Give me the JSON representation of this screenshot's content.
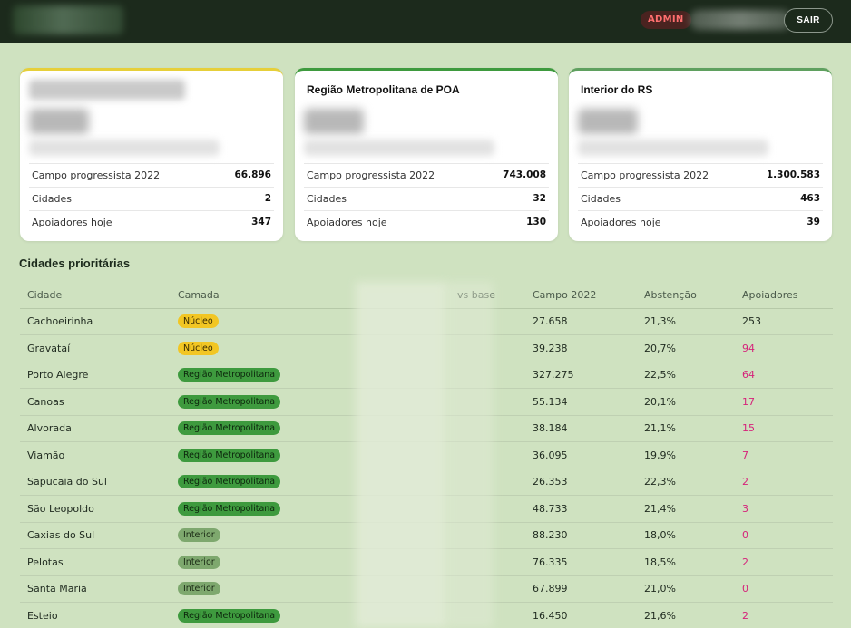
{
  "header": {
    "admin_label": "ADMIN",
    "logout_label": "SAIR"
  },
  "cards": [
    {
      "title": "",
      "rows": [
        {
          "label": "Campo progressista 2022",
          "value": "66.896"
        },
        {
          "label": "Cidades",
          "value": "2"
        },
        {
          "label": "Apoiadores hoje",
          "value": "347"
        }
      ]
    },
    {
      "title": "Região Metropolitana de POA",
      "rows": [
        {
          "label": "Campo progressista 2022",
          "value": "743.008"
        },
        {
          "label": "Cidades",
          "value": "32"
        },
        {
          "label": "Apoiadores hoje",
          "value": "130"
        }
      ]
    },
    {
      "title": "Interior do RS",
      "rows": [
        {
          "label": "Campo progressista 2022",
          "value": "1.300.583"
        },
        {
          "label": "Cidades",
          "value": "463"
        },
        {
          "label": "Apoiadores hoje",
          "value": "39"
        }
      ]
    }
  ],
  "section_title": "Cidades prioritárias",
  "table": {
    "headers": {
      "cidade": "Cidade",
      "camada": "Camada",
      "vs_base": "vs base",
      "campo": "Campo 2022",
      "abstencao": "Abstenção",
      "apoiadores": "Apoiadores"
    },
    "rows": [
      {
        "cidade": "Cachoeirinha",
        "camada": "Núcleo",
        "campo": "27.658",
        "abstencao": "21,3%",
        "apoiadores": "253"
      },
      {
        "cidade": "Gravataí",
        "camada": "Núcleo",
        "campo": "39.238",
        "abstencao": "20,7%",
        "apoiadores": "94"
      },
      {
        "cidade": "Porto Alegre",
        "camada": "Região Metropolitana",
        "campo": "327.275",
        "abstencao": "22,5%",
        "apoiadores": "64"
      },
      {
        "cidade": "Canoas",
        "camada": "Região Metropolitana",
        "campo": "55.134",
        "abstencao": "20,1%",
        "apoiadores": "17"
      },
      {
        "cidade": "Alvorada",
        "camada": "Região Metropolitana",
        "campo": "38.184",
        "abstencao": "21,1%",
        "apoiadores": "15"
      },
      {
        "cidade": "Viamão",
        "camada": "Região Metropolitana",
        "campo": "36.095",
        "abstencao": "19,9%",
        "apoiadores": "7"
      },
      {
        "cidade": "Sapucaia do Sul",
        "camada": "Região Metropolitana",
        "campo": "26.353",
        "abstencao": "22,3%",
        "apoiadores": "2"
      },
      {
        "cidade": "São Leopoldo",
        "camada": "Região Metropolitana",
        "campo": "48.733",
        "abstencao": "21,4%",
        "apoiadores": "3"
      },
      {
        "cidade": "Caxias do Sul",
        "camada": "Interior",
        "campo": "88.230",
        "abstencao": "18,0%",
        "apoiadores": "0"
      },
      {
        "cidade": "Pelotas",
        "camada": "Interior",
        "campo": "76.335",
        "abstencao": "18,5%",
        "apoiadores": "2"
      },
      {
        "cidade": "Santa Maria",
        "camada": "Interior",
        "campo": "67.899",
        "abstencao": "21,0%",
        "apoiadores": "0"
      },
      {
        "cidade": "Esteio",
        "camada": "Região Metropolitana",
        "campo": "16.450",
        "abstencao": "21,6%",
        "apoiadores": "2"
      }
    ]
  },
  "colors": {
    "topbar": "#1c2a1c",
    "background": "#cfe2c0",
    "nucleo_badge": "#f2c623",
    "metro_badge": "#3e9a3e",
    "interior_badge": "#7ea86e",
    "supporters_highlight": "#d6227a"
  }
}
